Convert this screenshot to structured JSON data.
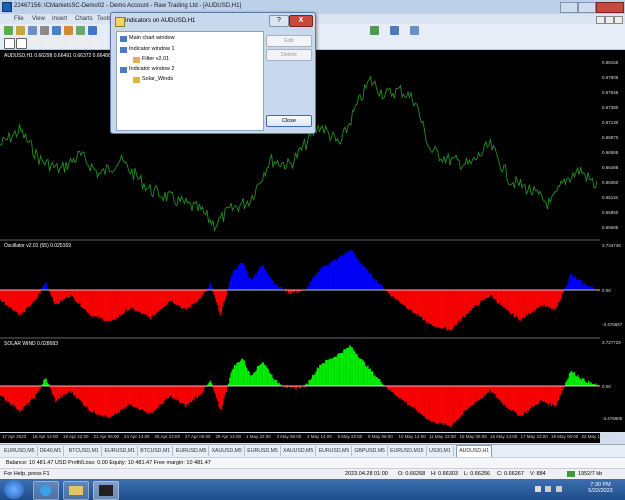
{
  "window": {
    "title": "22467156: ICMarketsSC-Demo02 - Demo Account - Raw Trading Ltd - [AUDUSD,H1]"
  },
  "menu": [
    "File",
    "View",
    "Insert",
    "Charts",
    "Tools"
  ],
  "chart": {
    "header": "AUDUSD,H1  0.66298 0.66491 0.66372 0.66488",
    "indicator1_label": "Oscillator v2.01 (55) 0.025169",
    "indicator2_label": "SOLAR WIND 0.028683",
    "price_axis": [
      "0.68155",
      "0.67905",
      "0.67645",
      "0.67380",
      "0.67130",
      "0.66870",
      "0.66585",
      "0.66488",
      "0.66360",
      "0.66115",
      "0.65850",
      "0.65585"
    ],
    "osc1_axis": [
      "3.734748",
      "0.00",
      "-3.475657"
    ],
    "osc2_axis": [
      "3.727729",
      "0.00",
      "-3.476805"
    ],
    "time_axis": [
      "17 Apr 2023",
      "18 Apr 14:00",
      "19 Apr 22:00",
      "21 Apr 06:00",
      "24 Apr 14:00",
      "25 Apr 22:00",
      "27 Apr 06:00",
      "28 Apr 14:00",
      "1 May 22:00",
      "3 May 06:00",
      "4 May 14:00",
      "5 May 22:00",
      "9 May 06:00",
      "10 May 14:00",
      "11 May 22:00",
      "15 May 06:00",
      "16 May 14:00",
      "17 May 22:00",
      "19 May 06:00",
      "22 May 14:00"
    ],
    "colors": {
      "price_line": "#1f8f1f",
      "positive_bars": "#0000ff",
      "negative_bars": "#ff0000",
      "positive_bars2": "#00ee00",
      "zero_line": "#ffffff"
    }
  },
  "dialog": {
    "title": "Indicators on AUDUSD,H1",
    "help_label": "?",
    "close_x": "X",
    "tree": [
      {
        "label": "Main chart window",
        "level": 0
      },
      {
        "label": "Indicator window 1",
        "level": 0
      },
      {
        "label": "Filter v2.01",
        "level": 1
      },
      {
        "label": "Indicator window 2",
        "level": 0
      },
      {
        "label": "Solar_Winds",
        "level": 1
      }
    ],
    "buttons": {
      "edit": "Edit",
      "delete": "Delete",
      "close": "Close"
    }
  },
  "tabs": [
    "EURUSD,M5",
    "DE40,M1",
    "BTCUSD,M1",
    "EURUSD,M1",
    "BTCUSD,M1",
    "EURUSD,M5",
    "XAUUSD,M5",
    "EURUSD,M5",
    "XAUUSD,M5",
    "EURUSD,M5",
    "GBPUSD,M5",
    "EURUSD,M15",
    "US30,M1",
    "AUDUSD,H1"
  ],
  "balance": "Balance: 10 481.47 USD  Profit/Loss: 0.00  Equity: 10 481.47  Free margin: 10 481.47",
  "status": {
    "help": "For Help, press F1",
    "datetime": "2023.04.28 01:00",
    "open": "O: 0.66268",
    "high": "H: 0.66303",
    "low": "L: 0.66256",
    "close": "C: 0.66267",
    "volume": "V: 884",
    "traffic": "1952/7 kb"
  },
  "clock": {
    "time": "7:30 PM",
    "date": "5/22/2023"
  }
}
